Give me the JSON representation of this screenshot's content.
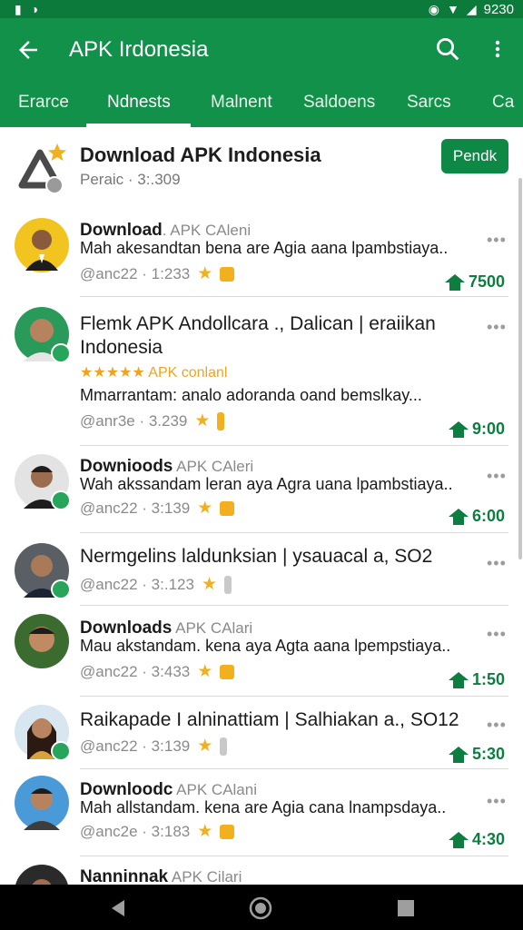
{
  "status_bar": {
    "time": "9230",
    "left_icons": [
      "sim-icon",
      "data-icon"
    ],
    "right_icons": [
      "alarm-icon",
      "wifi-icon",
      "signal-icon"
    ]
  },
  "app_bar": {
    "title": "APK Irdonesia"
  },
  "tabs": [
    {
      "label": "Erarce",
      "active": false
    },
    {
      "label": "Ndnests",
      "active": true
    },
    {
      "label": "Malnent",
      "active": false
    },
    {
      "label": "Saldoens",
      "active": false
    },
    {
      "label": "Sarcs",
      "active": false
    },
    {
      "label": "Ca",
      "active": false
    }
  ],
  "header": {
    "title": "Download APK Indonesia",
    "subtitle": "Peraic · 3:.309",
    "follow_label": "Pendk"
  },
  "items": [
    {
      "title": "Download",
      "title_light": ". APK CAleni",
      "desc": "Mah akesandtan bena are Agia aana lpambstiaya..",
      "meta": "@anc22 · 1:233",
      "count": "7500"
    },
    {
      "title_line1": "Flemk APK Andollcara ., Dalican | eraiikan",
      "title_line2": "Indonesia",
      "rating_label": "APK conlanl",
      "desc": "Mmarrantam: analo adoranda oand bemslkay...",
      "meta": "@anr3e · 3.239",
      "count": "9:00"
    },
    {
      "title": "Downioods",
      "title_light": " APK CAleri",
      "desc": "Wah akssandam leran aya Agra uana lpambstiaya..",
      "meta": "@anc22 · 3:139",
      "count": "6:00"
    },
    {
      "title_single": "Nermgelins laldunksian | ysauacal a, SO2",
      "meta": "@anc22 · 3:.123",
      "count": ""
    },
    {
      "title": "Downloads",
      "title_light": " APK CAlari",
      "desc": "Mau akstandam. kena aya Agta aana lpempstiaya..",
      "meta": "@anc22 · 3:433",
      "count": "1:50"
    },
    {
      "title_single": "Raikapade I alninattiam | Salhiakan a., SO12",
      "meta": "@anc22 · 3:139",
      "count": "5:30"
    },
    {
      "title": "Downloodc",
      "title_light": " APK CAlani",
      "desc": "Mah allstandam. kena are Agia cana lnampsdaya..",
      "meta": "@anc2e · 3:183",
      "count": "4:30"
    },
    {
      "title": "Nanninnak",
      "title_light": " APK Cilari"
    }
  ],
  "colors": {
    "primary": "#12914a",
    "status_bar": "#0b7a3b",
    "accent_green": "#0d7e3f",
    "star": "#f2b01e"
  }
}
